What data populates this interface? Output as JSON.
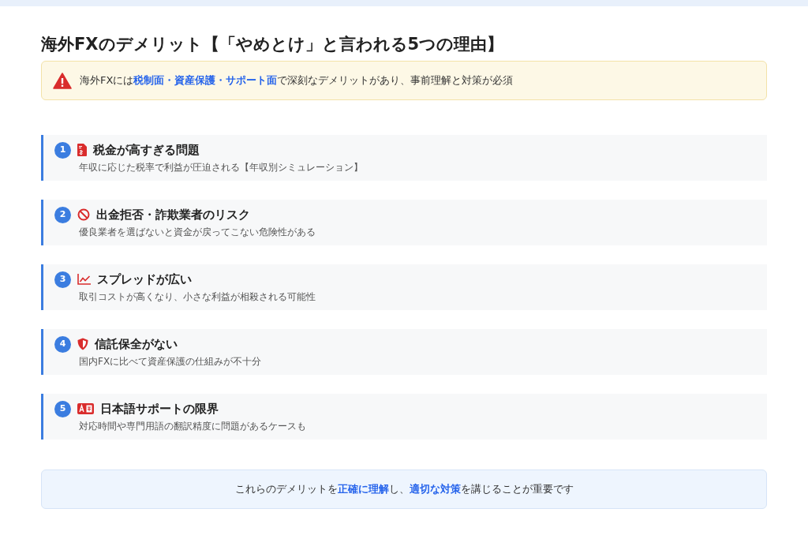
{
  "title": "海外FXのデメリット【「やめとけ」と言われる5つの理由】",
  "alert": {
    "text": "海外FXには**税制面・資産保護・サポート面**で深刻なデメリットがあり、事前理解と対策が必須"
  },
  "items": [
    {
      "number": "1",
      "kind": "tax",
      "heading": "税金が高すぎる問題",
      "description": "年収に応じた税率で利益が圧迫される【年収別シミュレーション】"
    },
    {
      "number": "2",
      "kind": "ban",
      "heading": "出金拒否・詐欺業者のリスク",
      "description": "優良業者を選ばないと資金が戻ってこない危険性がある"
    },
    {
      "number": "3",
      "kind": "chart",
      "heading": "スプレッドが広い",
      "description": "取引コストが高くなり、小さな利益が相殺される可能性"
    },
    {
      "number": "4",
      "kind": "shield",
      "heading": "信託保全がない",
      "description": "国内FXに比べて資産保護の仕組みが不十分"
    },
    {
      "number": "5",
      "kind": "language",
      "heading": "日本語サポートの限界",
      "description": "対応時間や専門用語の翻訳精度に問題があるケースも"
    }
  ],
  "summary": "これらのデメリットを**正確に理解**し、**適切な対策**を講じることが重要です"
}
